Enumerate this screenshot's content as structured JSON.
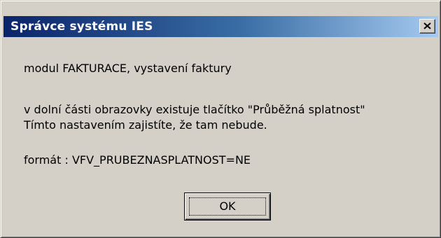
{
  "window": {
    "title": "Správce systému IES",
    "close_icon": "close-icon"
  },
  "message": {
    "line1": "modul FAKTURACE, vystavení faktury",
    "line2": "v dolní části obrazovky existuje tlačítko \"Průběžná splatnost\"",
    "line3": "Tímto nastavením zajistíte, že tam nebude.",
    "line4": "formát : VFV_PRUBEZNASPLATNOST=NE"
  },
  "buttons": {
    "ok_label": "OK"
  },
  "colors": {
    "dialog_face": "#d4d0c8",
    "titlebar_start": "#0a246a",
    "titlebar_end": "#a6caf0",
    "title_text": "#ffffff"
  }
}
